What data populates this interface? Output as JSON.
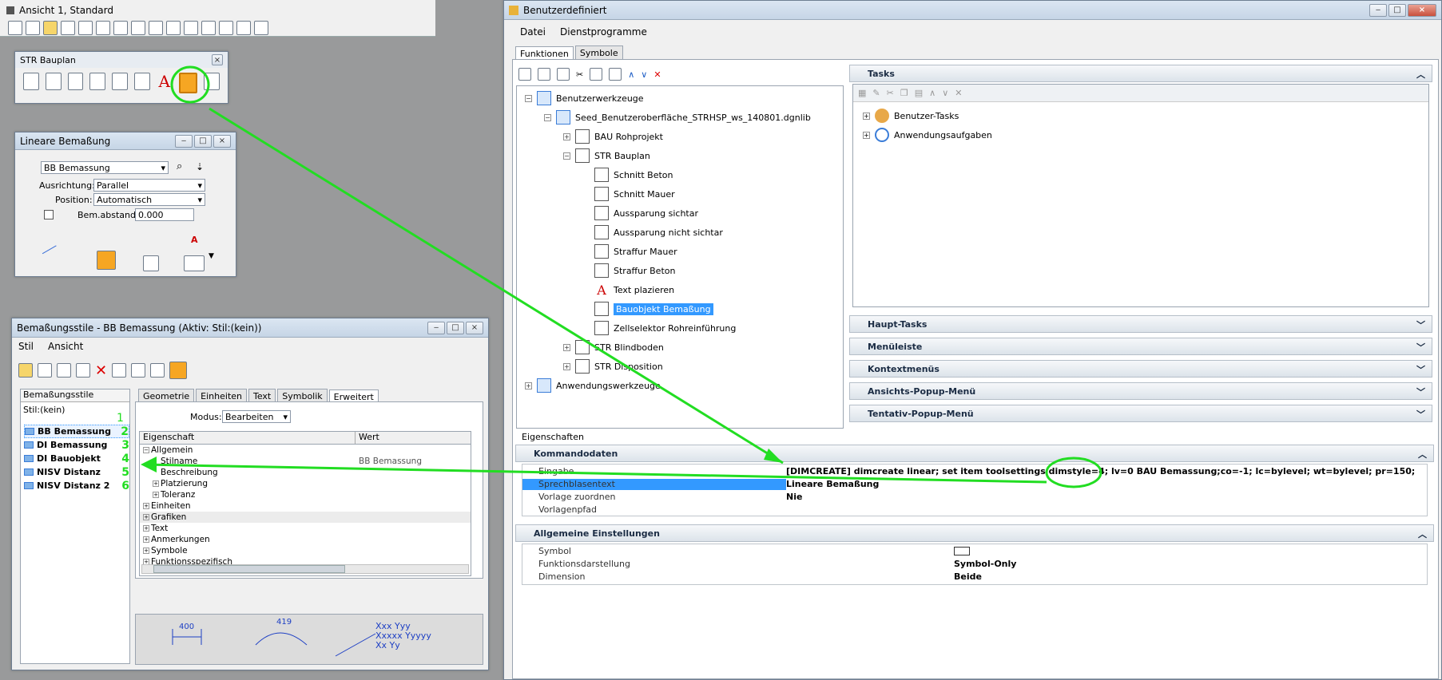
{
  "view": {
    "title": "Ansicht 1, Standard"
  },
  "bauplan": {
    "title": "STR Bauplan"
  },
  "lin": {
    "title": "Lineare Bemaßung",
    "style": "BB Bemassung",
    "ausrichtung_label": "Ausrichtung:",
    "ausrichtung": "Parallel",
    "position_label": "Position:",
    "position": "Automatisch",
    "abstand_label": "Bem.abstand:",
    "abstand": "0.000"
  },
  "bem": {
    "title": "Bemaßungsstile -  BB Bemassung (Aktiv: Stil:(kein))",
    "menu": [
      "Stil",
      "Ansicht"
    ],
    "list_header": "Bemaßungsstile",
    "list_none": "Stil:(kein)",
    "styles": [
      {
        "name": "BB Bemassung",
        "num": "2"
      },
      {
        "name": "DI Bemassung",
        "num": "3"
      },
      {
        "name": "DI Bauobjekt",
        "num": "4"
      },
      {
        "name": "NISV Distanz",
        "num": "5"
      },
      {
        "name": "NISV Distanz 2",
        "num": "6"
      }
    ],
    "num1": "1",
    "tabs": [
      "Geometrie",
      "Einheiten",
      "Text",
      "Symbolik",
      "Erweitert"
    ],
    "modus_label": "Modus:",
    "modus": "Bearbeiten",
    "col_prop": "Eigenschaft",
    "col_val": "Wert",
    "props": [
      "Allgemein",
      "Stilname",
      "Beschreibung",
      "Platzierung",
      "Toleranz",
      "Einheiten",
      "Grafiken",
      "Text",
      "Anmerkungen",
      "Symbole",
      "Funktionsspezifisch"
    ],
    "stilname_val": "BB Bemassung",
    "preview": {
      "d1": "400",
      "d2": "419",
      "t1": "Xxx Yyy",
      "t2": "Xxxxx Yyyyy",
      "t3": "Xx Yy"
    }
  },
  "ben": {
    "title": "Benutzerdefiniert",
    "menu": [
      "Datei",
      "Dienstprogramme"
    ],
    "tabs": [
      "Funktionen",
      "Symbole"
    ],
    "tree": [
      "Benutzerwerkzeuge",
      "Seed_Benutzeroberfläche_STRHSP_ws_140801.dgnlib",
      "BAU Rohprojekt",
      "STR Bauplan",
      "Schnitt Beton",
      "Schnitt Mauer",
      "Aussparung sichtar",
      "Aussparung nicht sichtar",
      "Straffur Mauer",
      "Straffur Beton",
      "Text plazieren",
      "Bauobjekt Bemaßung",
      "Zellselektor Rohreinführung",
      "STR Blindboden",
      "STR Disposition",
      "Anwendungswerkzeuge"
    ],
    "tasks_title": "Tasks",
    "tasks": [
      "Benutzer-Tasks",
      "Anwendungsaufgaben"
    ],
    "sections": [
      "Haupt-Tasks",
      "Menüleiste",
      "Kontextmenüs",
      "Ansichts-Popup-Menü",
      "Tentativ-Popup-Menü"
    ],
    "eig_label": "Eigenschaften",
    "kommando_title": "Kommandodaten",
    "kommando": [
      {
        "k": "Eingabe",
        "v": "[DIMCREATE] dimcreate linear; set item toolsettings dimstyle=4; lv=0 BAU Bemassung;co=-1; lc=bylevel; wt=bylevel; pr=150;"
      },
      {
        "k": "Sprechblasentext",
        "v": "Lineare Bemaßung"
      },
      {
        "k": "Vorlage zuordnen",
        "v": "Nie"
      },
      {
        "k": "Vorlagenpfad",
        "v": ""
      }
    ],
    "allg_title": "Allgemeine Einstellungen",
    "allg": [
      {
        "k": "Symbol",
        "v": ""
      },
      {
        "k": "Funktionsdarstellung",
        "v": "Symbol-Only"
      },
      {
        "k": "Dimension",
        "v": "Beide"
      }
    ]
  },
  "colors": {
    "highlight": "#3399ff",
    "annotation": "#22dd22",
    "active_tool": "#f6a623"
  }
}
